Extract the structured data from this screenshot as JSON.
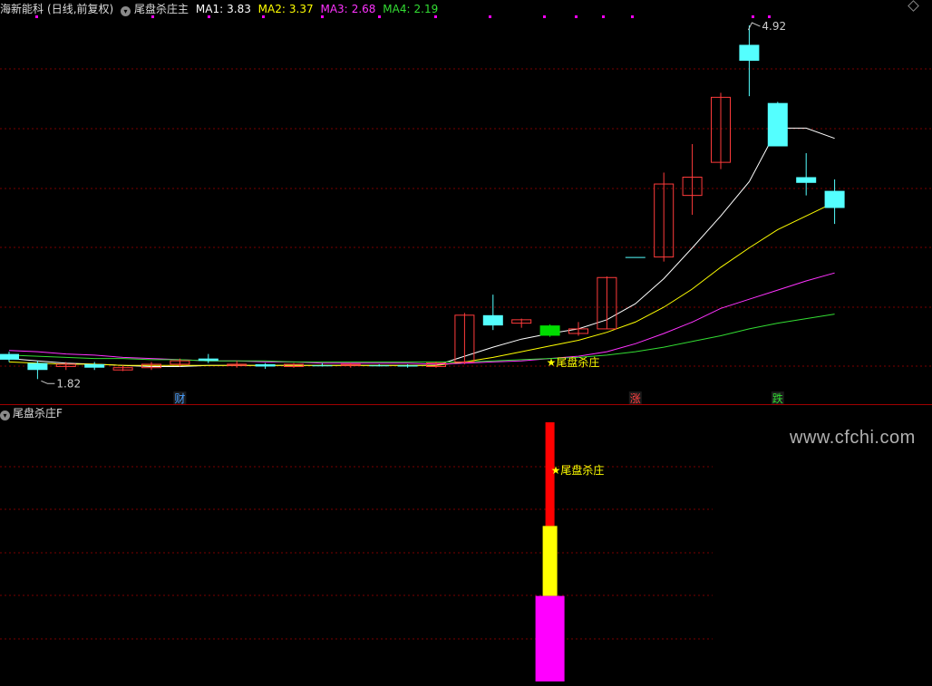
{
  "header": {
    "stock_name": "海新能科",
    "period": "(日线,前复权)",
    "indicator_name": "尾盘杀庄主",
    "ma": [
      {
        "label": "MA1:",
        "value": "3.83",
        "color": "#ffffff"
      },
      {
        "label": "MA2:",
        "value": "3.37",
        "color": "#ffff00"
      },
      {
        "label": "MA3:",
        "value": "2.68",
        "color": "#ff33ff"
      },
      {
        "label": "MA4:",
        "value": "2.19",
        "color": "#33dd33"
      }
    ]
  },
  "sub_header": {
    "indicator_name": "尾盘杀庄F"
  },
  "watermark": "www.cfchi.com",
  "colors": {
    "up": "#ff3b3b",
    "down": "#54ffff",
    "green_down": "#00dd00",
    "grid": "#7a0000",
    "separator": "#a00000"
  },
  "chart_data": [
    {
      "type": "candlestick",
      "title": "尾盘杀庄主",
      "ylim": [
        1.6,
        5.0
      ],
      "price_labels": {
        "high": "4.92",
        "low": "1.82"
      },
      "annotation": "★尾盘杀庄",
      "event_labels": [
        {
          "text": "财",
          "color": "#4aa0ff",
          "index": 6
        },
        {
          "text": "涨",
          "color": "#ff4040",
          "index": 22
        },
        {
          "text": "跌",
          "color": "#33dd33",
          "index": 27
        }
      ],
      "candles": [
        {
          "o": 2.04,
          "c": 1.99,
          "h": 2.06,
          "l": 1.97
        },
        {
          "o": 1.96,
          "c": 1.9,
          "h": 1.98,
          "l": 1.82
        },
        {
          "o": 1.93,
          "c": 1.95,
          "h": 1.97,
          "l": 1.9
        },
        {
          "o": 1.95,
          "c": 1.92,
          "h": 1.97,
          "l": 1.9
        },
        {
          "o": 1.9,
          "c": 1.92,
          "h": 1.94,
          "l": 1.89
        },
        {
          "o": 1.92,
          "c": 1.95,
          "h": 1.97,
          "l": 1.9
        },
        {
          "o": 1.95,
          "c": 1.98,
          "h": 2.0,
          "l": 1.93
        },
        {
          "o": 2.0,
          "c": 1.98,
          "h": 2.04,
          "l": 1.96
        },
        {
          "o": 1.94,
          "c": 1.95,
          "h": 1.98,
          "l": 1.92
        },
        {
          "o": 1.95,
          "c": 1.93,
          "h": 1.96,
          "l": 1.91
        },
        {
          "o": 1.93,
          "c": 1.95,
          "h": 1.96,
          "l": 1.92
        },
        {
          "o": 1.94,
          "c": 1.94,
          "h": 1.96,
          "l": 1.93
        },
        {
          "o": 1.94,
          "c": 1.95,
          "h": 1.96,
          "l": 1.92
        },
        {
          "o": 1.94,
          "c": 1.94,
          "h": 1.95,
          "l": 1.93
        },
        {
          "o": 1.94,
          "c": 1.93,
          "h": 1.95,
          "l": 1.92
        },
        {
          "o": 1.93,
          "c": 1.96,
          "h": 1.97,
          "l": 1.92
        },
        {
          "o": 1.97,
          "c": 2.38,
          "h": 2.4,
          "l": 1.95
        },
        {
          "o": 2.38,
          "c": 2.29,
          "h": 2.56,
          "l": 2.25
        },
        {
          "o": 2.31,
          "c": 2.34,
          "h": 2.35,
          "l": 2.27
        },
        {
          "o": 2.29,
          "c": 2.2,
          "h": 2.3,
          "l": 2.19
        },
        {
          "o": 2.22,
          "c": 2.26,
          "h": 2.32,
          "l": 2.2
        },
        {
          "o": 2.26,
          "c": 2.71,
          "h": 2.72,
          "l": 2.26
        },
        {
          "o": 2.89,
          "c": 2.89,
          "h": 2.89,
          "l": 2.89
        },
        {
          "o": 2.89,
          "c": 3.53,
          "h": 3.63,
          "l": 2.85
        },
        {
          "o": 3.43,
          "c": 3.59,
          "h": 3.88,
          "l": 3.26
        },
        {
          "o": 3.72,
          "c": 4.29,
          "h": 4.33,
          "l": 3.66
        },
        {
          "o": 4.75,
          "c": 4.61,
          "h": 4.92,
          "l": 4.3
        },
        {
          "o": 4.24,
          "c": 3.86,
          "h": 4.25,
          "l": 3.86
        },
        {
          "o": 3.59,
          "c": 3.54,
          "h": 3.8,
          "l": 3.43
        },
        {
          "o": 3.47,
          "c": 3.32,
          "h": 3.57,
          "l": 3.18
        }
      ],
      "ma_lines": [
        {
          "name": "MA1",
          "color": "#ffffff",
          "values": [
            2.0,
            1.98,
            1.96,
            1.95,
            1.94,
            1.93,
            1.93,
            1.94,
            1.94,
            1.94,
            1.94,
            1.94,
            1.94,
            1.94,
            1.94,
            1.94,
            2.02,
            2.1,
            2.17,
            2.22,
            2.26,
            2.34,
            2.48,
            2.7,
            2.97,
            3.25,
            3.55,
            4.02,
            4.02,
            3.93
          ]
        },
        {
          "name": "MA2",
          "color": "#ffff00",
          "values": [
            1.97,
            1.96,
            1.95,
            1.95,
            1.94,
            1.94,
            1.94,
            1.94,
            1.94,
            1.94,
            1.94,
            1.94,
            1.94,
            1.94,
            1.94,
            1.94,
            1.97,
            2.01,
            2.06,
            2.11,
            2.16,
            2.23,
            2.32,
            2.45,
            2.61,
            2.8,
            2.97,
            3.13,
            3.25,
            3.37
          ]
        },
        {
          "name": "MA3",
          "color": "#ff33ff",
          "values": [
            2.07,
            2.06,
            2.04,
            2.03,
            2.01,
            2.0,
            1.99,
            1.98,
            1.98,
            1.97,
            1.97,
            1.96,
            1.96,
            1.96,
            1.96,
            1.95,
            1.96,
            1.97,
            1.98,
            2.0,
            2.02,
            2.06,
            2.13,
            2.22,
            2.32,
            2.44,
            2.52,
            2.6,
            2.68,
            2.75
          ]
        },
        {
          "name": "MA4",
          "color": "#33dd33",
          "values": [
            2.03,
            2.02,
            2.01,
            2.0,
            2.0,
            1.99,
            1.99,
            1.98,
            1.98,
            1.98,
            1.97,
            1.97,
            1.97,
            1.97,
            1.97,
            1.97,
            1.97,
            1.98,
            1.99,
            2.0,
            2.01,
            2.03,
            2.06,
            2.1,
            2.15,
            2.2,
            2.26,
            2.31,
            2.35,
            2.39
          ]
        }
      ]
    },
    {
      "type": "bar",
      "title": "尾盘杀庄F",
      "annotation": "★尾盘杀庄",
      "ylim": [
        0,
        100
      ],
      "index": 19,
      "segments": [
        {
          "name": "red",
          "color": "#ff0000",
          "from": 60,
          "to": 100
        },
        {
          "name": "yellow",
          "color": "#ffff00",
          "from": 33,
          "to": 60
        },
        {
          "name": "magenta",
          "color": "#ff00ff",
          "from": 0,
          "to": 33
        }
      ]
    }
  ]
}
